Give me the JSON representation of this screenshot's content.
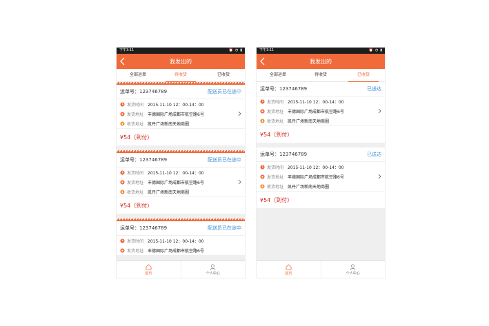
{
  "status_bar": {
    "time": "下午3:11"
  },
  "header": {
    "title": "我发出的"
  },
  "tabs": [
    "全部运单",
    "待收货",
    "已收货"
  ],
  "left_phone": {
    "active_tab": 1,
    "cards": [
      {
        "order_label": "运单号：123746789",
        "status": "配送员已在途中",
        "send_time_label": "发货时间",
        "send_time": "2015-11-10 12：00-14：00",
        "send_addr_label": "发货地址",
        "send_addr": "丰德国际广场成都市航空路6号",
        "recv_addr_label": "收货地址",
        "recv_addr": "凯丹广场新南天地商圈",
        "price": "¥54（到付）"
      },
      {
        "order_label": "运单号：123746789",
        "status": "配送员已在途中",
        "send_time_label": "发货时间",
        "send_time": "2015-11-10 12：00-14：00",
        "send_addr_label": "发货地址",
        "send_addr": "丰德国际广场成都市航空路6号",
        "recv_addr_label": "收货地址",
        "recv_addr": "凯丹广场新南天地商圈",
        "price": "¥54（到付）"
      },
      {
        "order_label": "运单号：123746789",
        "status": "配送员已在途中",
        "send_time_label": "发货时间",
        "send_time": "2015-11-10 12：00-14：00",
        "send_addr_label": "发货地址",
        "send_addr": "丰德国际广场成都市航空路6号"
      }
    ]
  },
  "right_phone": {
    "active_tab": 2,
    "cards": [
      {
        "order_label": "运单号：123746789",
        "status": "已送达",
        "send_time_label": "发货时间",
        "send_time": "2015-11-10 12：00-14：00",
        "send_addr_label": "发货地址",
        "send_addr": "丰德国际广场成都市航空路6号",
        "recv_addr_label": "收货地址",
        "recv_addr": "凯丹广场新南天地商圈",
        "price": "¥54（到付）"
      },
      {
        "order_label": "运单号：123746789",
        "status": "已送达",
        "send_time_label": "发货时间",
        "send_time": "2015-11-10 12：00-14：00",
        "send_addr_label": "发货地址",
        "send_addr": "丰德国际广场成都市航空路6号",
        "recv_addr_label": "收货地址",
        "recv_addr": "凯丹广场新南天地商圈",
        "price": "¥54（到付）"
      }
    ]
  },
  "bottom_nav": {
    "home": "首页",
    "profile": "个人中心"
  },
  "colors": {
    "accent": "#f06a3a",
    "status_blue": "#3f8fd6",
    "price_red": "#d0281a"
  },
  "icons": [
    "back-icon",
    "clock-icon",
    "send-location-icon",
    "receive-location-icon",
    "chevron-right-icon",
    "home-icon",
    "user-icon"
  ]
}
